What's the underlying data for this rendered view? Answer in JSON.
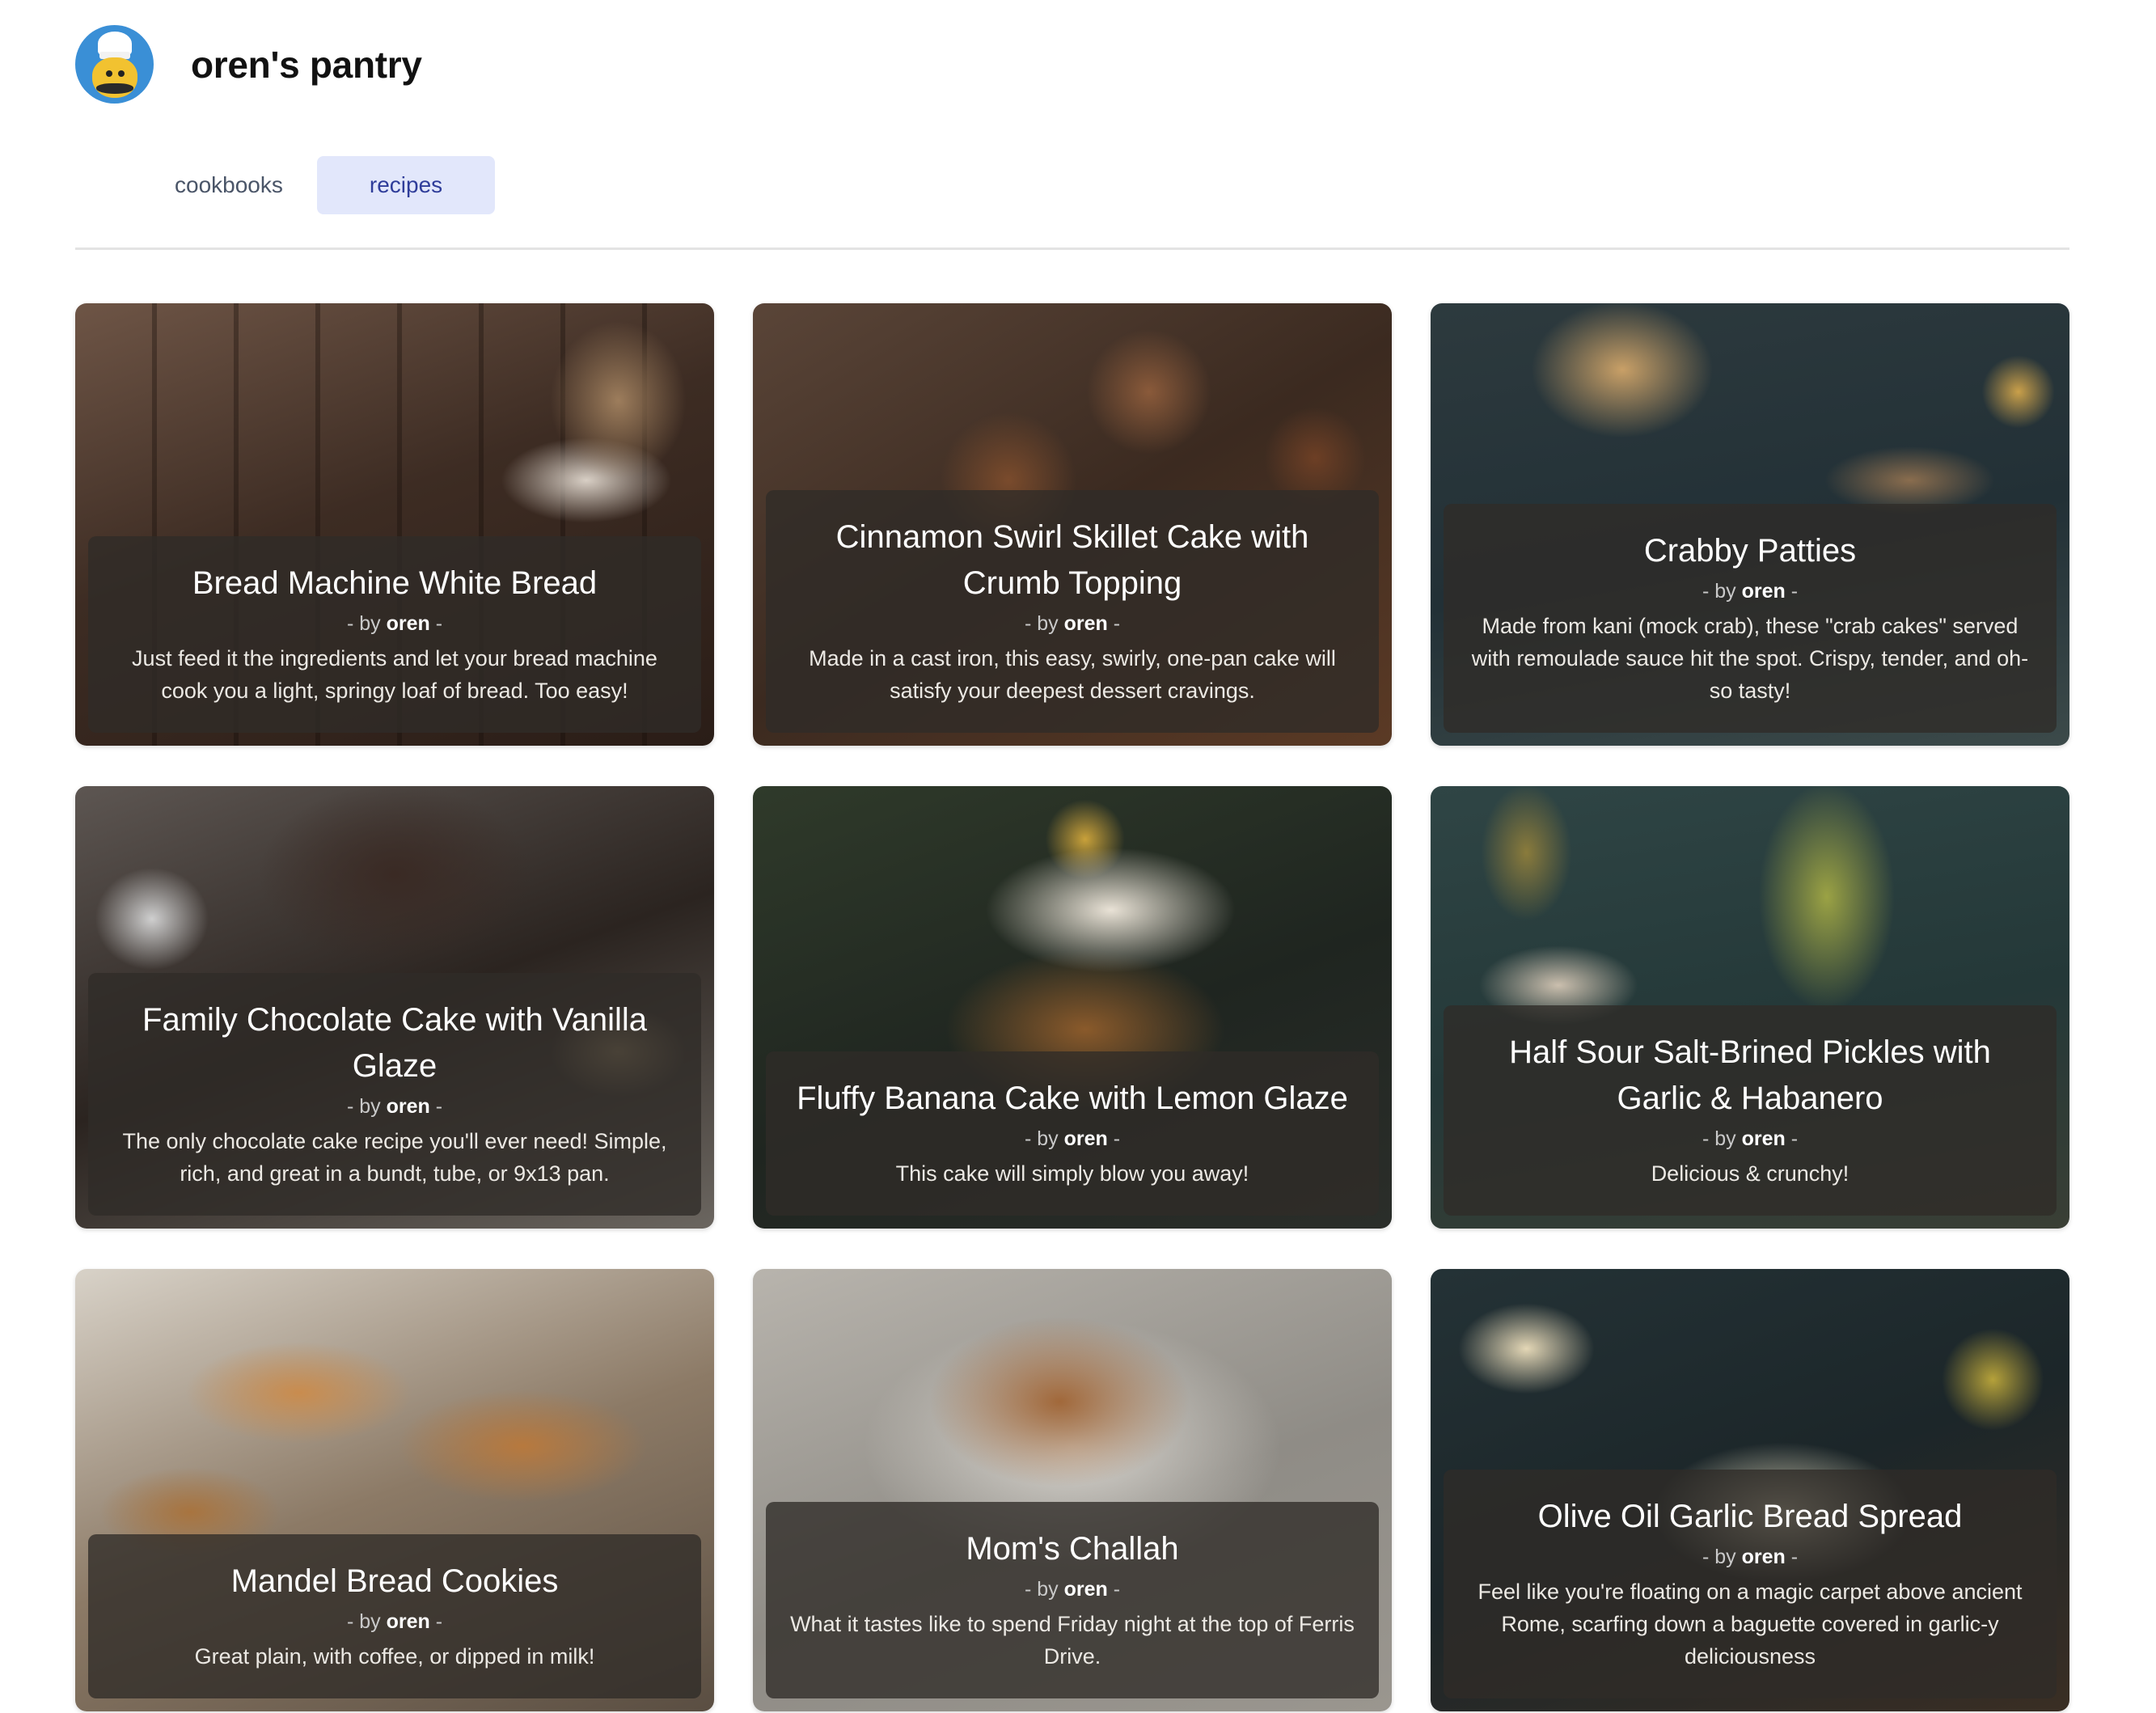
{
  "site": {
    "name": "oren's pantry",
    "logo_icon": "chef-mustache-icon",
    "accent": "#e2e7fb"
  },
  "tabs": [
    {
      "label": "cookbooks",
      "active": false
    },
    {
      "label": "recipes",
      "active": true
    }
  ],
  "recipes": [
    {
      "title": "Bread Machine White Bread",
      "by_prefix": "- by",
      "author": "oren",
      "by_suffix": "-",
      "description": "Just feed it the ingredients and let your bread machine cook you a light, springy loaf of bread. Too easy!"
    },
    {
      "title": "Cinnamon Swirl Skillet Cake with Crumb Topping",
      "by_prefix": "- by",
      "author": "oren",
      "by_suffix": "-",
      "description": "Made in a cast iron, this easy, swirly, one-pan cake will satisfy your deepest dessert cravings."
    },
    {
      "title": "Crabby Patties",
      "by_prefix": "- by",
      "author": "oren",
      "by_suffix": "-",
      "description": "Made from kani (mock crab), these \"crab cakes\" served with remoulade sauce hit the spot. Crispy, tender, and oh-so tasty!"
    },
    {
      "title": "Family Chocolate Cake with Vanilla Glaze",
      "by_prefix": "- by",
      "author": "oren",
      "by_suffix": "-",
      "description": "The only chocolate cake recipe you'll ever need! Simple, rich, and great in a bundt, tube, or 9x13 pan."
    },
    {
      "title": "Fluffy Banana Cake with Lemon Glaze",
      "by_prefix": "- by",
      "author": "oren",
      "by_suffix": "-",
      "description": "This cake will simply blow you away!"
    },
    {
      "title": "Half Sour Salt-Brined Pickles with Garlic & Habanero",
      "by_prefix": "- by",
      "author": "oren",
      "by_suffix": "-",
      "description": "Delicious & crunchy!"
    },
    {
      "title": "Mandel Bread Cookies",
      "by_prefix": "- by",
      "author": "oren",
      "by_suffix": "-",
      "description": "Great plain, with coffee, or dipped in milk!"
    },
    {
      "title": "Mom's Challah",
      "by_prefix": "- by",
      "author": "oren",
      "by_suffix": "-",
      "description": "What it tastes like to spend Friday night at the top of Ferris Drive."
    },
    {
      "title": "Olive Oil Garlic Bread Spread",
      "by_prefix": "- by",
      "author": "oren",
      "by_suffix": "-",
      "description": "Feel like you're floating on a magic carpet above ancient Rome, scarfing down a baguette covered in garlic-y deliciousness"
    }
  ]
}
